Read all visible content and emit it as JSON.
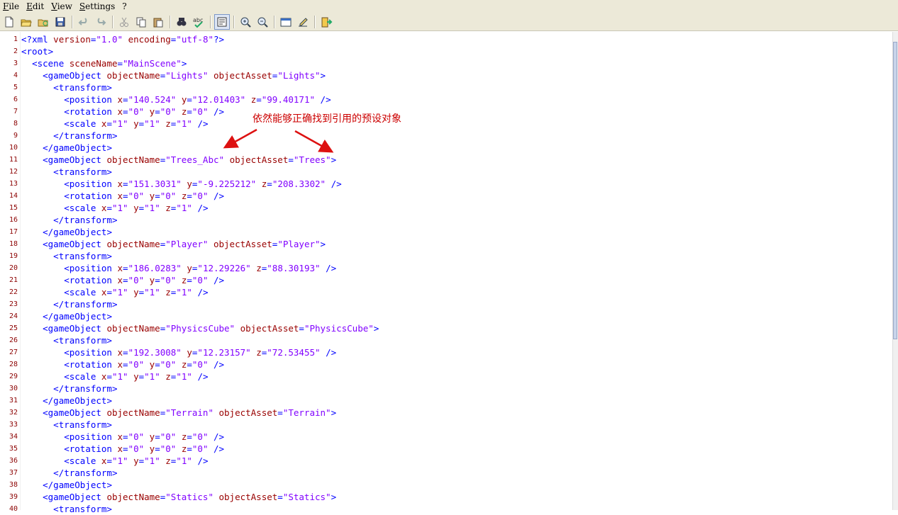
{
  "menu": [
    "File",
    "Edit",
    "View",
    "Settings",
    "?"
  ],
  "toolbar": [
    {
      "icon": "new-file-icon"
    },
    {
      "icon": "open-folder-icon"
    },
    {
      "icon": "reload-icon"
    },
    {
      "icon": "save-icon"
    },
    {
      "sep": true
    },
    {
      "icon": "undo-icon"
    },
    {
      "icon": "redo-icon"
    },
    {
      "sep": true
    },
    {
      "icon": "cut-icon"
    },
    {
      "icon": "copy-icon"
    },
    {
      "icon": "paste-icon"
    },
    {
      "sep": true
    },
    {
      "icon": "find-icon"
    },
    {
      "icon": "spell-check-icon"
    },
    {
      "sep": true
    },
    {
      "icon": "word-wrap-icon",
      "active": true
    },
    {
      "sep": true
    },
    {
      "icon": "zoom-in-icon"
    },
    {
      "icon": "zoom-out-icon"
    },
    {
      "sep": true
    },
    {
      "icon": "settings-window-icon"
    },
    {
      "icon": "edit-pen-icon"
    },
    {
      "sep": true
    },
    {
      "icon": "exit-icon"
    }
  ],
  "annotation": "依然能够正确找到引用的预设对象",
  "code_lines": [
    "<?xml version=\"1.0\" encoding=\"utf-8\"?>",
    "<root>",
    "  <scene sceneName=\"MainScene\">",
    "    <gameObject objectName=\"Lights\" objectAsset=\"Lights\">",
    "      <transform>",
    "        <position x=\"140.524\" y=\"12.01403\" z=\"99.40171\" />",
    "        <rotation x=\"0\" y=\"0\" z=\"0\" />",
    "        <scale x=\"1\" y=\"1\" z=\"1\" />",
    "      </transform>",
    "    </gameObject>",
    "    <gameObject objectName=\"Trees_Abc\" objectAsset=\"Trees\">",
    "      <transform>",
    "        <position x=\"151.3031\" y=\"-9.225212\" z=\"208.3302\" />",
    "        <rotation x=\"0\" y=\"0\" z=\"0\" />",
    "        <scale x=\"1\" y=\"1\" z=\"1\" />",
    "      </transform>",
    "    </gameObject>",
    "    <gameObject objectName=\"Player\" objectAsset=\"Player\">",
    "      <transform>",
    "        <position x=\"186.0283\" y=\"12.29226\" z=\"88.30193\" />",
    "        <rotation x=\"0\" y=\"0\" z=\"0\" />",
    "        <scale x=\"1\" y=\"1\" z=\"1\" />",
    "      </transform>",
    "    </gameObject>",
    "    <gameObject objectName=\"PhysicsCube\" objectAsset=\"PhysicsCube\">",
    "      <transform>",
    "        <position x=\"192.3008\" y=\"12.23157\" z=\"72.53455\" />",
    "        <rotation x=\"0\" y=\"0\" z=\"0\" />",
    "        <scale x=\"1\" y=\"1\" z=\"1\" />",
    "      </transform>",
    "    </gameObject>",
    "    <gameObject objectName=\"Terrain\" objectAsset=\"Terrain\">",
    "      <transform>",
    "        <position x=\"0\" y=\"0\" z=\"0\" />",
    "        <rotation x=\"0\" y=\"0\" z=\"0\" />",
    "        <scale x=\"1\" y=\"1\" z=\"1\" />",
    "      </transform>",
    "    </gameObject>",
    "    <gameObject objectName=\"Statics\" objectAsset=\"Statics\">",
    "      <transform>"
  ],
  "colors": {
    "tag": "#0000ff",
    "attr": "#990000",
    "value": "#8000ff",
    "annotation": "#cc0000"
  }
}
